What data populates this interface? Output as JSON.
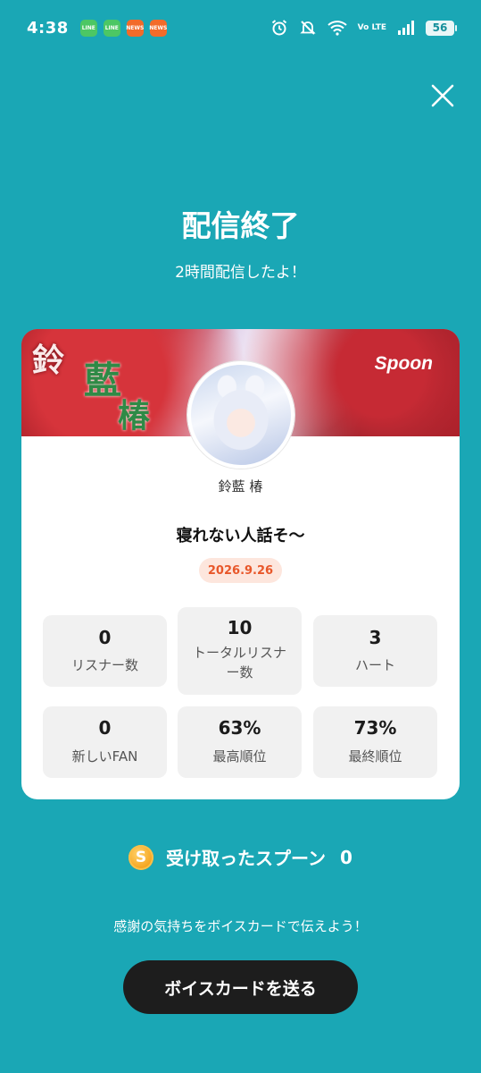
{
  "status_bar": {
    "time": "4:38",
    "notifications": [
      {
        "icon": "line-icon",
        "label": "LINE"
      },
      {
        "icon": "line-icon",
        "label": "LINE"
      },
      {
        "icon": "app-icon",
        "label": "NEWS"
      },
      {
        "icon": "app-icon",
        "label": "NEWS"
      }
    ],
    "network": "Vo LTE",
    "battery": "56"
  },
  "header": {
    "title": "配信終了",
    "subtitle": "2時間配信したよ！"
  },
  "card": {
    "banner": {
      "calligraphy": [
        "鈴",
        "藍",
        "椿"
      ],
      "logo": "Spoon"
    },
    "username": "鈴藍 椿",
    "live_title": "寝れない人話そ～",
    "date": "2026.9.26",
    "stats": [
      {
        "value": "0",
        "label": "リスナー数"
      },
      {
        "value": "10",
        "label": "トータルリスナー数"
      },
      {
        "value": "3",
        "label": "ハート"
      },
      {
        "value": "0",
        "label": "新しいFAN"
      },
      {
        "value": "63%",
        "label": "最高順位"
      },
      {
        "value": "73%",
        "label": "最終順位"
      }
    ]
  },
  "received": {
    "coin_symbol": "S",
    "label": "受け取ったスプーン",
    "count": "0"
  },
  "footer": {
    "message": "感謝の気持ちをボイスカードで伝えよう！",
    "button_label": "ボイスカードを送る"
  },
  "colors": {
    "background": "#1aa7b5",
    "date_badge_bg": "#fde6dd",
    "date_badge_text": "#e8572a",
    "button_bg": "#1d1d1d"
  }
}
